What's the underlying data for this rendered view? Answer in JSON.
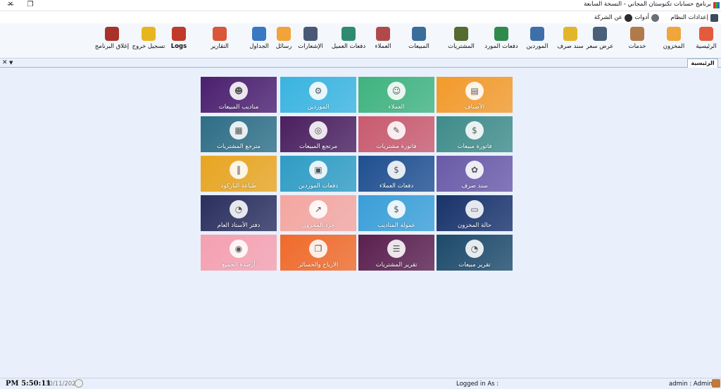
{
  "window": {
    "title": "برنامج حسابات تكنوستان المجاني - النسخة السابعة",
    "minimize_icon": "minimize-icon",
    "restore_icon": "restore-icon",
    "close_icon": "close-icon"
  },
  "menu": {
    "items": [
      {
        "label": "إعدادات النظام",
        "icon": "folder-icon",
        "color": "#3b4a5e"
      },
      {
        "label": "أدوات",
        "icon": "gear-icon",
        "color": "#6a6f78"
      },
      {
        "label": "عن الشركة",
        "icon": "info-icon",
        "color": "#2b2b2b"
      }
    ]
  },
  "ribbon": {
    "buttons": [
      {
        "label": "الرئيسية",
        "icon": "home-icon",
        "color": "#e25b3c"
      },
      {
        "label": "المخزون",
        "icon": "warehouse-icon",
        "color": "#f0a63a"
      },
      {
        "label": "خدمات",
        "icon": "services-icon",
        "color": "#b07a4a"
      },
      {
        "label": "عرض سعر",
        "icon": "quote-icon",
        "color": "#4a6078"
      },
      {
        "label": "سند صرف",
        "icon": "voucher-icon",
        "color": "#e2b52a"
      },
      {
        "label": "الموردين",
        "icon": "suppliers-icon",
        "color": "#3f6fa8"
      },
      {
        "label": "دفعات المورد",
        "icon": "supplier-payments-icon",
        "color": "#2f8a4c"
      },
      {
        "label": "المشتريات",
        "icon": "purchases-icon",
        "color": "#556b2f"
      },
      {
        "label": "المبيعات",
        "icon": "sales-icon",
        "color": "#3a6d9a"
      },
      {
        "label": "العملاء",
        "icon": "customers-icon",
        "color": "#b04a4a"
      },
      {
        "label": "دفعات العميل",
        "icon": "customer-payments-icon",
        "color": "#2e8b72"
      },
      {
        "label": "الإشعارات",
        "icon": "notifications-icon",
        "color": "#4a5a74"
      },
      {
        "label": "رسائل",
        "icon": "sms-icon",
        "color": "#f2a33a"
      },
      {
        "label": "الجداول",
        "icon": "tables-icon",
        "color": "#3a78c2"
      },
      {
        "label": "التقارير",
        "icon": "reports-icon",
        "color": "#d9563a"
      },
      {
        "label": "Logs",
        "icon": "logs-icon",
        "color": "#c0392b"
      },
      {
        "label": "تسجيل خروج",
        "icon": "lock-icon",
        "color": "#e8b51f"
      },
      {
        "label": "إغلاق البرنامج",
        "icon": "exit-icon",
        "color": "#a8322a"
      }
    ]
  },
  "tabs": {
    "active": "الرئيسية",
    "close_icon": "close-icon",
    "dropdown_icon": "dropdown-icon"
  },
  "tiles": [
    {
      "label": "الأصناف",
      "icon": "products-icon",
      "glyph": "▤",
      "bg": "#f39a2a"
    },
    {
      "label": "العملاء",
      "icon": "customers-icon",
      "glyph": "☺",
      "bg": "#3fb37f"
    },
    {
      "label": "الموردين",
      "icon": "suppliers-icon",
      "glyph": "⚙",
      "bg": "#39b4e0"
    },
    {
      "label": "مناديب المبيعات",
      "icon": "sales-rep-icon",
      "glyph": "☻",
      "bg": "#4b1f6e"
    },
    {
      "label": "فاتورة مبيعات",
      "icon": "sales-invoice-icon",
      "glyph": "$",
      "bg": "#3f8c8a"
    },
    {
      "label": "فاتورة مشتريات",
      "icon": "purchase-invoice-icon",
      "glyph": "✎",
      "bg": "#c95a6e"
    },
    {
      "label": "مرتجع المبيعات",
      "icon": "sales-return-icon",
      "glyph": "◎",
      "bg": "#4a1f5e"
    },
    {
      "label": "مترجع المشتريات",
      "icon": "purchase-return-icon",
      "glyph": "▦",
      "bg": "#2e6e86"
    },
    {
      "label": "سند صرف",
      "icon": "expense-voucher-icon",
      "glyph": "✿",
      "bg": "#6a5aa8"
    },
    {
      "label": "دفعات العملاء",
      "icon": "customer-payments-icon",
      "glyph": "$",
      "bg": "#1f4f8f"
    },
    {
      "label": "دفعات الموردين",
      "icon": "supplier-payments-icon",
      "glyph": "▣",
      "bg": "#2f9cc4"
    },
    {
      "label": "طباعة الباركود",
      "icon": "barcode-icon",
      "glyph": "‖",
      "bg": "#e8a520"
    },
    {
      "label": "حالة المخزون",
      "icon": "inventory-status-icon",
      "glyph": "▭",
      "bg": "#18336b"
    },
    {
      "label": "عمولة المناديب",
      "icon": "commission-icon",
      "glyph": "$",
      "bg": "#3a9fd8"
    },
    {
      "label": "جرد المخزون",
      "icon": "stocktake-icon",
      "glyph": "↗",
      "bg": "#f4a6a0"
    },
    {
      "label": "دفتر الأستاذ العام",
      "icon": "ledger-icon",
      "glyph": "◔",
      "bg": "#2a2f5e"
    },
    {
      "label": "تقرير مبيعات",
      "icon": "sales-report-icon",
      "glyph": "◔",
      "bg": "#1d4a6a"
    },
    {
      "label": "تقرير المشتريات",
      "icon": "purchases-report-icon",
      "glyph": "☰",
      "bg": "#5a1f4e"
    },
    {
      "label": "الارباح والخسائر",
      "icon": "profit-loss-icon",
      "glyph": "❐",
      "bg": "#f06a2a"
    },
    {
      "label": "أرصدة الجميع",
      "icon": "balances-icon",
      "glyph": "◉",
      "bg": "#f5a0b0"
    }
  ],
  "status": {
    "time": "PM 5:50:11",
    "date": "30/11/2023",
    "logged_in_label": "Logged in As :",
    "user": "admin : Admin"
  }
}
